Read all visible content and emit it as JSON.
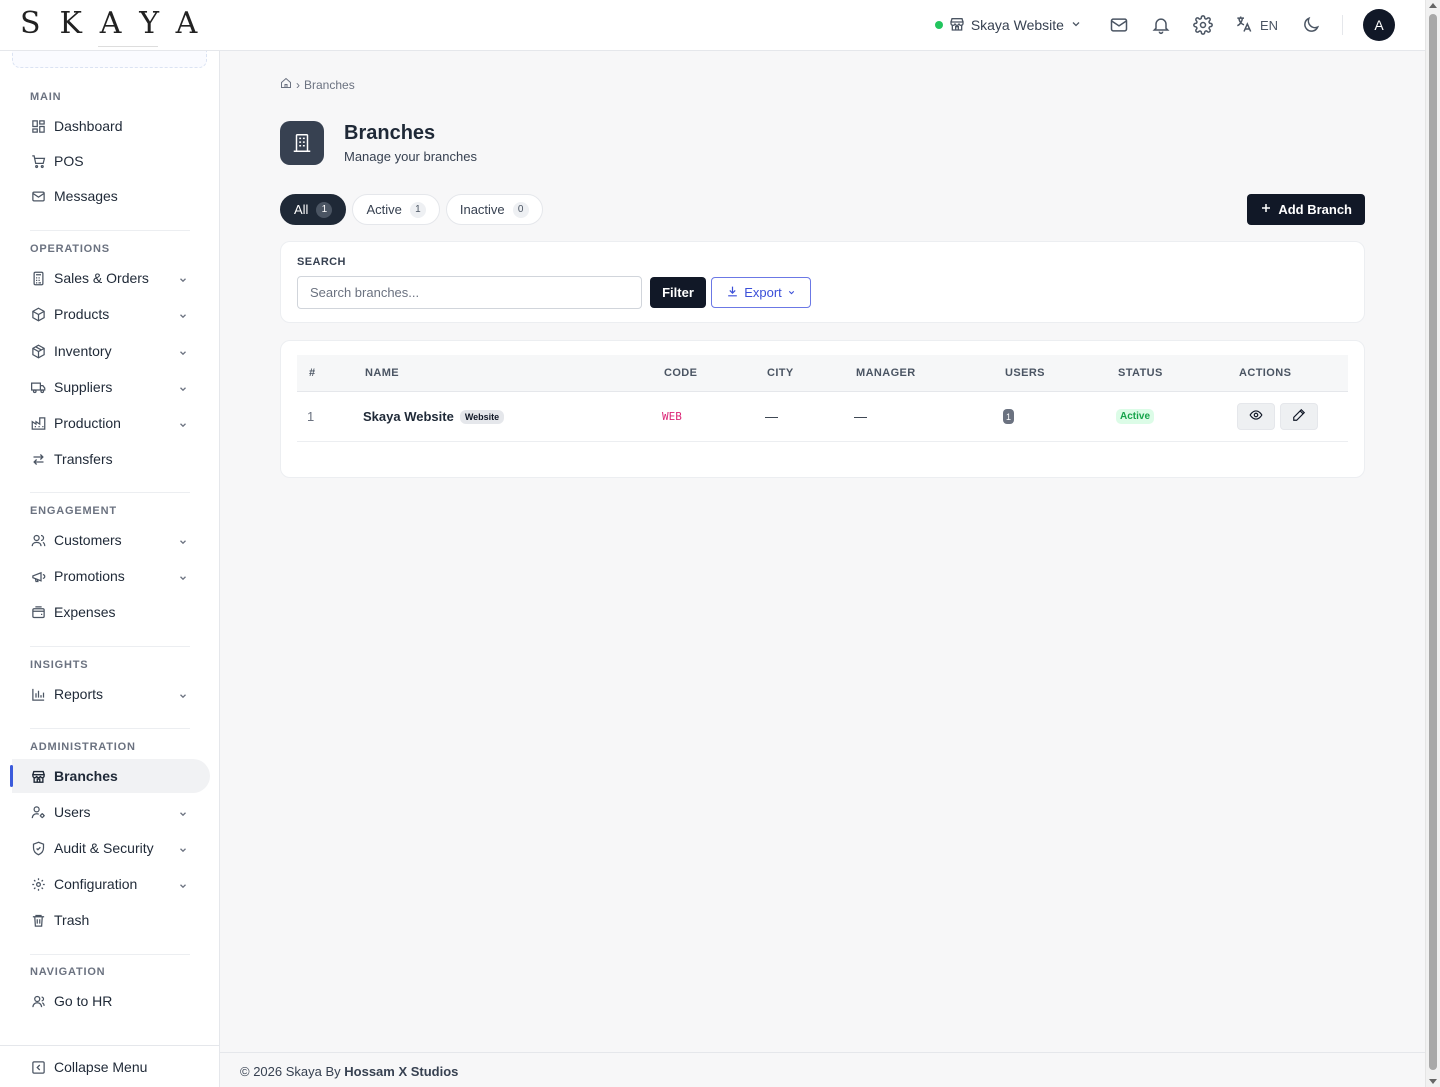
{
  "app": {
    "logo": "SKAYA"
  },
  "topbar": {
    "store_name": "Skaya Website",
    "language": "EN",
    "avatar_initial": "A",
    "icons": [
      "mail-icon",
      "bell-icon",
      "gear-icon",
      "translate-icon",
      "moon-icon"
    ]
  },
  "sidebar": {
    "sections": {
      "main": "MAIN",
      "operations": "OPERATIONS",
      "engagement": "ENGAGEMENT",
      "insights": "INSIGHTS",
      "administration": "ADMINISTRATION",
      "navigation": "NAVIGATION"
    },
    "items": {
      "dashboard": "Dashboard",
      "pos": "POS",
      "messages": "Messages",
      "sales_orders": "Sales & Orders",
      "products": "Products",
      "inventory": "Inventory",
      "suppliers": "Suppliers",
      "production": "Production",
      "transfers": "Transfers",
      "customers": "Customers",
      "promotions": "Promotions",
      "expenses": "Expenses",
      "reports": "Reports",
      "branches": "Branches",
      "users": "Users",
      "audit_security": "Audit & Security",
      "configuration": "Configuration",
      "trash": "Trash",
      "go_to_hr": "Go to HR"
    },
    "active_item": "Branches",
    "collapse_label": "Collapse Menu"
  },
  "breadcrumb": {
    "current": "Branches"
  },
  "page": {
    "title": "Branches",
    "subtitle": "Manage your branches"
  },
  "tabs": [
    {
      "label": "All",
      "count": "1"
    },
    {
      "label": "Active",
      "count": "1"
    },
    {
      "label": "Inactive",
      "count": "0"
    }
  ],
  "add_button_label": "Add Branch",
  "search": {
    "label": "SEARCH",
    "placeholder": "Search branches...",
    "value": "",
    "filter_label": "Filter",
    "export_label": "Export"
  },
  "table": {
    "columns": [
      "#",
      "NAME",
      "CODE",
      "CITY",
      "MANAGER",
      "USERS",
      "STATUS",
      "ACTIONS"
    ],
    "rows": [
      {
        "index": "1",
        "name": "Skaya Website",
        "tag": "Website",
        "code": "WEB",
        "city": "—",
        "manager": "—",
        "users": "1",
        "status": "Active"
      }
    ]
  },
  "footer": {
    "prefix": "© 2026 Skaya By",
    "brand": "Hossam X Studios"
  },
  "colors": {
    "accent": "#3b5bdb",
    "primary_dark": "#111827",
    "status_active": "#16a34a",
    "code_pink": "#db2777",
    "online_dot": "#22c55e"
  }
}
